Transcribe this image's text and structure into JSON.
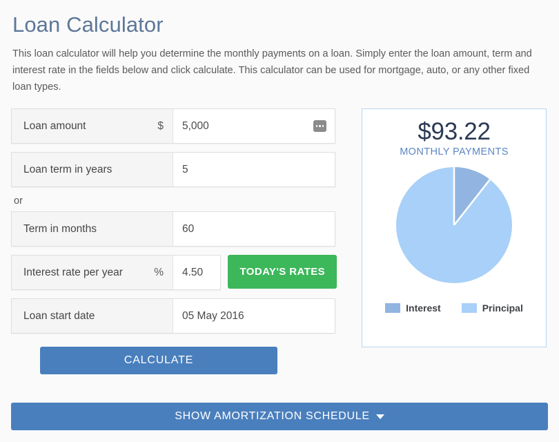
{
  "header": {
    "title": "Loan Calculator",
    "intro": "This loan calculator will help you determine the monthly payments on a loan. Simply enter the loan amount, term and interest rate in the fields below and click calculate. This calculator can be used for mortgage, auto, or any other fixed loan types."
  },
  "form": {
    "or_label": "or",
    "fields": [
      {
        "label": "Loan amount",
        "unit": "$",
        "value": "5,000",
        "has_picker": true
      },
      {
        "label": "Loan term in years",
        "unit": "",
        "value": "5",
        "has_picker": false
      },
      {
        "label": "Term in months",
        "unit": "",
        "value": "60",
        "has_picker": false
      },
      {
        "label": "Interest rate per year",
        "unit": "%",
        "value": "4.50",
        "has_picker": false
      },
      {
        "label": "Loan start date",
        "unit": "",
        "value": "05 May 2016",
        "has_picker": false
      }
    ],
    "todays_rates_label": "TODAY'S RATES",
    "calculate_label": "CALCULATE"
  },
  "result": {
    "amount": "$93.22",
    "caption": "MONTHLY PAYMENTS"
  },
  "chart_data": {
    "type": "pie",
    "title": "",
    "categories": [
      "Interest",
      "Principal"
    ],
    "values": [
      10.6,
      89.4
    ],
    "colors": [
      "#92b4e0",
      "#a8d0f8"
    ],
    "legend_position": "bottom",
    "start_angle": 0,
    "legend": [
      {
        "label": "Interest",
        "color": "#92b4e0"
      },
      {
        "label": "Principal",
        "color": "#a8d0f8"
      }
    ]
  },
  "footer": {
    "amortization_label": "SHOW AMORTIZATION SCHEDULE",
    "caret_icon": "chevron-down-icon"
  },
  "colors": {
    "title": "#5d7799",
    "primary_button": "#4a7fbd",
    "rates_button": "#3cb75a",
    "panel_border": "#b8d4f0",
    "amount_text": "#2b3a55",
    "caption_text": "#5b86c4",
    "page_background": "#fafafa"
  }
}
